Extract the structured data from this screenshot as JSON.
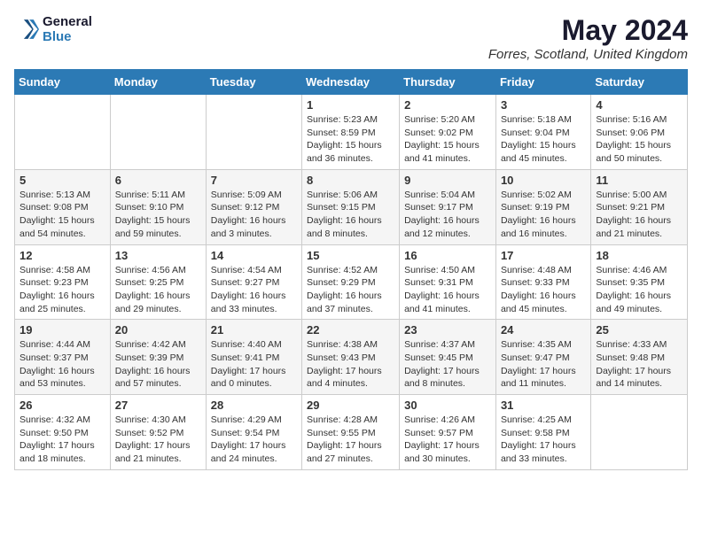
{
  "logo": {
    "line1": "General",
    "line2": "Blue"
  },
  "title": "May 2024",
  "subtitle": "Forres, Scotland, United Kingdom",
  "days_of_week": [
    "Sunday",
    "Monday",
    "Tuesday",
    "Wednesday",
    "Thursday",
    "Friday",
    "Saturday"
  ],
  "weeks": [
    [
      {
        "day": "",
        "info": ""
      },
      {
        "day": "",
        "info": ""
      },
      {
        "day": "",
        "info": ""
      },
      {
        "day": "1",
        "info": "Sunrise: 5:23 AM\nSunset: 8:59 PM\nDaylight: 15 hours\nand 36 minutes."
      },
      {
        "day": "2",
        "info": "Sunrise: 5:20 AM\nSunset: 9:02 PM\nDaylight: 15 hours\nand 41 minutes."
      },
      {
        "day": "3",
        "info": "Sunrise: 5:18 AM\nSunset: 9:04 PM\nDaylight: 15 hours\nand 45 minutes."
      },
      {
        "day": "4",
        "info": "Sunrise: 5:16 AM\nSunset: 9:06 PM\nDaylight: 15 hours\nand 50 minutes."
      }
    ],
    [
      {
        "day": "5",
        "info": "Sunrise: 5:13 AM\nSunset: 9:08 PM\nDaylight: 15 hours\nand 54 minutes."
      },
      {
        "day": "6",
        "info": "Sunrise: 5:11 AM\nSunset: 9:10 PM\nDaylight: 15 hours\nand 59 minutes."
      },
      {
        "day": "7",
        "info": "Sunrise: 5:09 AM\nSunset: 9:12 PM\nDaylight: 16 hours\nand 3 minutes."
      },
      {
        "day": "8",
        "info": "Sunrise: 5:06 AM\nSunset: 9:15 PM\nDaylight: 16 hours\nand 8 minutes."
      },
      {
        "day": "9",
        "info": "Sunrise: 5:04 AM\nSunset: 9:17 PM\nDaylight: 16 hours\nand 12 minutes."
      },
      {
        "day": "10",
        "info": "Sunrise: 5:02 AM\nSunset: 9:19 PM\nDaylight: 16 hours\nand 16 minutes."
      },
      {
        "day": "11",
        "info": "Sunrise: 5:00 AM\nSunset: 9:21 PM\nDaylight: 16 hours\nand 21 minutes."
      }
    ],
    [
      {
        "day": "12",
        "info": "Sunrise: 4:58 AM\nSunset: 9:23 PM\nDaylight: 16 hours\nand 25 minutes."
      },
      {
        "day": "13",
        "info": "Sunrise: 4:56 AM\nSunset: 9:25 PM\nDaylight: 16 hours\nand 29 minutes."
      },
      {
        "day": "14",
        "info": "Sunrise: 4:54 AM\nSunset: 9:27 PM\nDaylight: 16 hours\nand 33 minutes."
      },
      {
        "day": "15",
        "info": "Sunrise: 4:52 AM\nSunset: 9:29 PM\nDaylight: 16 hours\nand 37 minutes."
      },
      {
        "day": "16",
        "info": "Sunrise: 4:50 AM\nSunset: 9:31 PM\nDaylight: 16 hours\nand 41 minutes."
      },
      {
        "day": "17",
        "info": "Sunrise: 4:48 AM\nSunset: 9:33 PM\nDaylight: 16 hours\nand 45 minutes."
      },
      {
        "day": "18",
        "info": "Sunrise: 4:46 AM\nSunset: 9:35 PM\nDaylight: 16 hours\nand 49 minutes."
      }
    ],
    [
      {
        "day": "19",
        "info": "Sunrise: 4:44 AM\nSunset: 9:37 PM\nDaylight: 16 hours\nand 53 minutes."
      },
      {
        "day": "20",
        "info": "Sunrise: 4:42 AM\nSunset: 9:39 PM\nDaylight: 16 hours\nand 57 minutes."
      },
      {
        "day": "21",
        "info": "Sunrise: 4:40 AM\nSunset: 9:41 PM\nDaylight: 17 hours\nand 0 minutes."
      },
      {
        "day": "22",
        "info": "Sunrise: 4:38 AM\nSunset: 9:43 PM\nDaylight: 17 hours\nand 4 minutes."
      },
      {
        "day": "23",
        "info": "Sunrise: 4:37 AM\nSunset: 9:45 PM\nDaylight: 17 hours\nand 8 minutes."
      },
      {
        "day": "24",
        "info": "Sunrise: 4:35 AM\nSunset: 9:47 PM\nDaylight: 17 hours\nand 11 minutes."
      },
      {
        "day": "25",
        "info": "Sunrise: 4:33 AM\nSunset: 9:48 PM\nDaylight: 17 hours\nand 14 minutes."
      }
    ],
    [
      {
        "day": "26",
        "info": "Sunrise: 4:32 AM\nSunset: 9:50 PM\nDaylight: 17 hours\nand 18 minutes."
      },
      {
        "day": "27",
        "info": "Sunrise: 4:30 AM\nSunset: 9:52 PM\nDaylight: 17 hours\nand 21 minutes."
      },
      {
        "day": "28",
        "info": "Sunrise: 4:29 AM\nSunset: 9:54 PM\nDaylight: 17 hours\nand 24 minutes."
      },
      {
        "day": "29",
        "info": "Sunrise: 4:28 AM\nSunset: 9:55 PM\nDaylight: 17 hours\nand 27 minutes."
      },
      {
        "day": "30",
        "info": "Sunrise: 4:26 AM\nSunset: 9:57 PM\nDaylight: 17 hours\nand 30 minutes."
      },
      {
        "day": "31",
        "info": "Sunrise: 4:25 AM\nSunset: 9:58 PM\nDaylight: 17 hours\nand 33 minutes."
      },
      {
        "day": "",
        "info": ""
      }
    ]
  ]
}
